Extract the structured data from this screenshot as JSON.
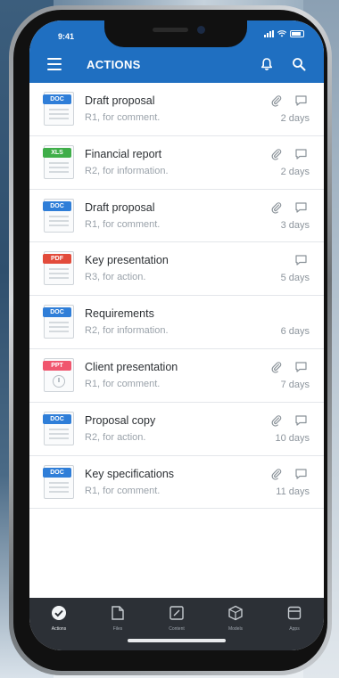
{
  "status": {
    "time": "9:41"
  },
  "header": {
    "title": "ACTIONS"
  },
  "colors": {
    "header_bg": "#1f6fc1",
    "doc": "#2f7ed8",
    "xls": "#3fae49",
    "pdf": "#e24b3b",
    "ppt": "#f0566e"
  },
  "items": [
    {
      "type": "DOC",
      "name": "Draft proposal",
      "sub": "R1, for comment.",
      "days": "2 days",
      "attachment": true,
      "comment": true
    },
    {
      "type": "XLS",
      "name": "Financial report",
      "sub": "R2, for information.",
      "days": "2 days",
      "attachment": true,
      "comment": true
    },
    {
      "type": "DOC",
      "name": "Draft proposal",
      "sub": "R1, for comment.",
      "days": "3 days",
      "attachment": true,
      "comment": true
    },
    {
      "type": "PDF",
      "name": "Key presentation",
      "sub": "R3, for action.",
      "days": "5 days",
      "attachment": false,
      "comment": true
    },
    {
      "type": "DOC",
      "name": "Requirements",
      "sub": "R2, for information.",
      "days": "6 days",
      "attachment": false,
      "comment": false
    },
    {
      "type": "PPT",
      "name": "Client presentation",
      "sub": "R1, for comment.",
      "days": "7 days",
      "attachment": true,
      "comment": true
    },
    {
      "type": "DOC",
      "name": "Proposal copy",
      "sub": "R2, for action.",
      "days": "10 days",
      "attachment": true,
      "comment": true
    },
    {
      "type": "DOC",
      "name": "Key specifications",
      "sub": "R1, for comment.",
      "days": "11 days",
      "attachment": true,
      "comment": true
    }
  ],
  "nav": [
    {
      "label": "Actions",
      "icon": "check-circle-icon",
      "active": true
    },
    {
      "label": "Files",
      "icon": "folder-icon",
      "active": false
    },
    {
      "label": "Content",
      "icon": "edit-icon",
      "active": false
    },
    {
      "label": "Models",
      "icon": "cube-icon",
      "active": false
    },
    {
      "label": "Apps",
      "icon": "apps-icon",
      "active": false
    }
  ]
}
